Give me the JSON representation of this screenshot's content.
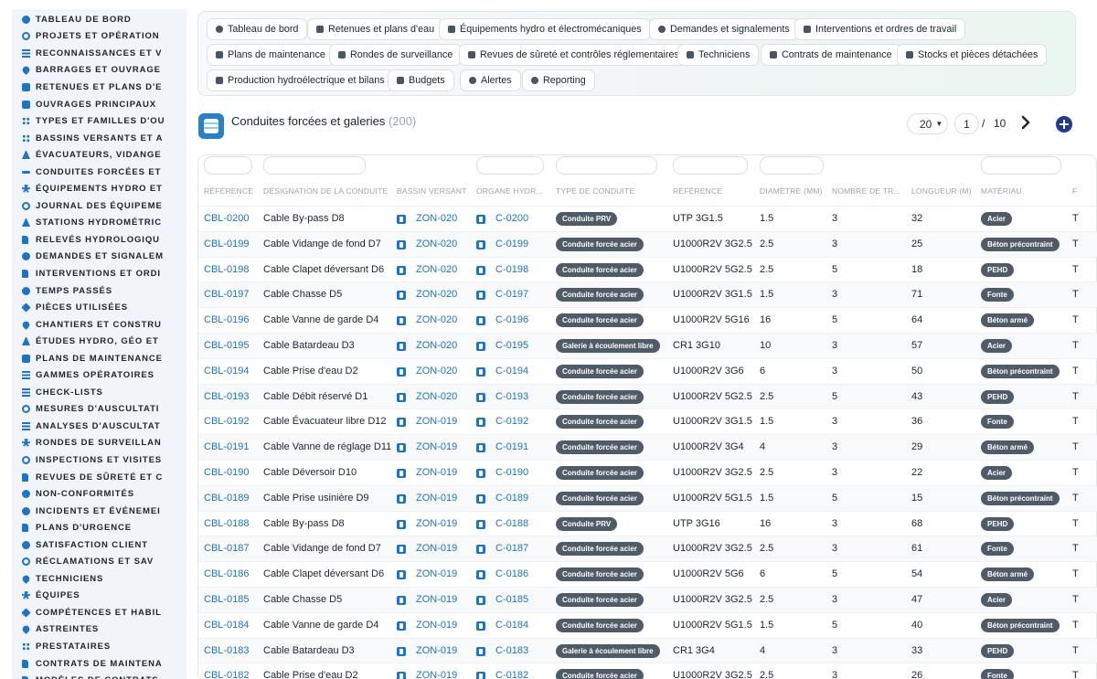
{
  "sidebar": {
    "items": [
      {
        "label": "TABLEAU DE BORD",
        "icon": "dashboard-icon"
      },
      {
        "label": "PROJETS ET OPÉRATION",
        "icon": "target-icon"
      },
      {
        "label": "RECONNAISSANCES ET V",
        "icon": "list-icon"
      },
      {
        "label": "BARRAGES ET OUVRAGE",
        "icon": "map-pin-icon"
      },
      {
        "label": "RETENUES ET PLANS D'E",
        "icon": "building-icon"
      },
      {
        "label": "OUVRAGES PRINCIPAUX",
        "icon": "box-icon"
      },
      {
        "label": "TYPES ET FAMILLES D'OU",
        "icon": "sitemap-icon"
      },
      {
        "label": "BASSINS VERSANTS ET A",
        "icon": "grid-icon"
      },
      {
        "label": "ÉVACUATEURS, VIDANGE",
        "icon": "valve-icon"
      },
      {
        "label": "CONDUITES FORCÉES ET",
        "icon": "pipe-icon"
      },
      {
        "label": "ÉQUIPEMENTS HYDRO ET",
        "icon": "cogs-icon"
      },
      {
        "label": "JOURNAL DES ÉQUIPEME",
        "icon": "history-icon"
      },
      {
        "label": "STATIONS HYDROMÉTRIC",
        "icon": "tower-icon"
      },
      {
        "label": "RELEVÉS HYDROLOGIQU",
        "icon": "clipboard-icon"
      },
      {
        "label": "DEMANDES ET SIGNALEM",
        "icon": "question-icon"
      },
      {
        "label": "INTERVENTIONS ET ORDI",
        "icon": "clipboard-check-icon"
      },
      {
        "label": "TEMPS PASSÉS",
        "icon": "clock-icon"
      },
      {
        "label": "PIÈCES UTILISÉES",
        "icon": "cube-icon"
      },
      {
        "label": "CHANTIERS ET CONSTRU",
        "icon": "hammer-icon"
      },
      {
        "label": "ÉTUDES HYDRO, GÉO ET",
        "icon": "flask-icon"
      },
      {
        "label": "PLANS DE MAINTENANCE",
        "icon": "calendar-icon"
      },
      {
        "label": "GAMMES OPÉRATOIRES",
        "icon": "list-ol-icon"
      },
      {
        "label": "CHECK-LISTS",
        "icon": "check-list-icon"
      },
      {
        "label": "MESURES D'AUSCULTATI",
        "icon": "gauge-icon"
      },
      {
        "label": "ANALYSES D'AUSCULTAT",
        "icon": "chart-icon"
      },
      {
        "label": "RONDES DE SURVEILLAN",
        "icon": "route-icon"
      },
      {
        "label": "INSPECTIONS ET VISITES",
        "icon": "search-icon"
      },
      {
        "label": "REVUES DE SÛRETÉ ET C",
        "icon": "file-shield-icon"
      },
      {
        "label": "NON-CONFORMITÉS",
        "icon": "warning-icon"
      },
      {
        "label": "INCIDENTS ET ÉVÉNEMEI",
        "icon": "alert-icon"
      },
      {
        "label": "PLANS D'URGENCE",
        "icon": "file-alert-icon"
      },
      {
        "label": "SATISFACTION CLIENT",
        "icon": "smile-icon"
      },
      {
        "label": "RÉCLAMATIONS ET SAV",
        "icon": "headset-icon"
      },
      {
        "label": "TECHNICIENS",
        "icon": "helmet-icon"
      },
      {
        "label": "ÉQUIPES",
        "icon": "users-icon"
      },
      {
        "label": "COMPÉTENCES ET HABIL",
        "icon": "certificate-icon"
      },
      {
        "label": "ASTREINTES",
        "icon": "phone-icon"
      },
      {
        "label": "PRESTATAIRES",
        "icon": "handshake-icon"
      },
      {
        "label": "CONTRATS DE MAINTENA",
        "icon": "contract-icon"
      },
      {
        "label": "MODÈLES DE CONTRATS",
        "icon": "template-icon"
      }
    ]
  },
  "nav": {
    "buttons": [
      {
        "label": "Tableau de bord",
        "icon": "dashboard-icon"
      },
      {
        "label": "Retenues et plans d'eau",
        "icon": "building-icon"
      },
      {
        "label": "Équipements hydro et électromécaniques",
        "icon": "cogs-icon"
      },
      {
        "label": "Demandes et signalements",
        "icon": "question-icon"
      },
      {
        "label": "Interventions et ordres de travail",
        "icon": "clipboard-check-icon"
      },
      {
        "label": "Plans de maintenance",
        "icon": "calendar-icon"
      },
      {
        "label": "Rondes de surveillance",
        "icon": "route-icon"
      },
      {
        "label": "Revues de sûreté et contrôles réglementaires",
        "icon": "file-shield-icon"
      },
      {
        "label": "Techniciens",
        "icon": "helmet-icon"
      },
      {
        "label": "Contrats de maintenance",
        "icon": "contract-icon"
      },
      {
        "label": "Stocks et pièces détachées",
        "icon": "boxes-icon"
      },
      {
        "label": "Production hydroélectrique et bilans",
        "icon": "bolt-icon"
      },
      {
        "label": "Budgets",
        "icon": "money-icon"
      },
      {
        "label": "Alertes",
        "icon": "bell-icon"
      },
      {
        "label": "Reporting",
        "icon": "pie-chart-icon"
      }
    ]
  },
  "page": {
    "title": "Conduites forcées et galeries",
    "count": "(200)",
    "per_page": "20",
    "current_page": "1",
    "page_separator": "/",
    "total_pages": "10"
  },
  "table": {
    "headers": [
      "RÉFÉRENCE",
      "DÉSIGNATION DE LA CONDUITE",
      "BASSIN VERSANT",
      "ORGANE HYDR...",
      "TYPE DE CONDUITE",
      "RÉFÉRENCE",
      "DIAMÈTRE (MM)",
      "NOMBRE DE TR...",
      "LONGUEUR (M)",
      "MATÉRIAU",
      "F"
    ],
    "rows": [
      {
        "ref": "CBL-0200",
        "name": "Cable By-pass D8",
        "basin": "ZON-020",
        "organ": "C-0200",
        "type": "Conduite PRV",
        "cable_ref": "UTP 3G1.5",
        "diameter": "1.5",
        "count": "3",
        "length": "32",
        "material": "Acier",
        "extra": "T"
      },
      {
        "ref": "CBL-0199",
        "name": "Cable Vidange de fond D7",
        "basin": "ZON-020",
        "organ": "C-0199",
        "type": "Conduite forcée acier",
        "cable_ref": "U1000R2V 3G2.5",
        "diameter": "2.5",
        "count": "3",
        "length": "25",
        "material": "Béton précontraint",
        "extra": "T"
      },
      {
        "ref": "CBL-0198",
        "name": "Cable Clapet déversant D6",
        "basin": "ZON-020",
        "organ": "C-0198",
        "type": "Conduite forcée acier",
        "cable_ref": "U1000R2V 5G2.5",
        "diameter": "2.5",
        "count": "5",
        "length": "18",
        "material": "PEHD",
        "extra": "T"
      },
      {
        "ref": "CBL-0197",
        "name": "Cable Chasse D5",
        "basin": "ZON-020",
        "organ": "C-0197",
        "type": "Conduite forcée acier",
        "cable_ref": "U1000R2V 3G1.5",
        "diameter": "1.5",
        "count": "3",
        "length": "71",
        "material": "Fonte",
        "extra": "T"
      },
      {
        "ref": "CBL-0196",
        "name": "Cable Vanne de garde D4",
        "basin": "ZON-020",
        "organ": "C-0196",
        "type": "Conduite forcée acier",
        "cable_ref": "U1000R2V 5G16",
        "diameter": "16",
        "count": "5",
        "length": "64",
        "material": "Béton armé",
        "extra": "T"
      },
      {
        "ref": "CBL-0195",
        "name": "Cable Batardeau D3",
        "basin": "ZON-020",
        "organ": "C-0195",
        "type": "Galerie à écoulement libre",
        "cable_ref": "CR1 3G10",
        "diameter": "10",
        "count": "3",
        "length": "57",
        "material": "Acier",
        "extra": "T"
      },
      {
        "ref": "CBL-0194",
        "name": "Cable Prise d'eau D2",
        "basin": "ZON-020",
        "organ": "C-0194",
        "type": "Conduite forcée acier",
        "cable_ref": "U1000R2V 3G6",
        "diameter": "6",
        "count": "3",
        "length": "50",
        "material": "Béton précontraint",
        "extra": "T"
      },
      {
        "ref": "CBL-0193",
        "name": "Cable Débit réservé D1",
        "basin": "ZON-020",
        "organ": "C-0193",
        "type": "Conduite forcée acier",
        "cable_ref": "U1000R2V 5G2.5",
        "diameter": "2.5",
        "count": "5",
        "length": "43",
        "material": "PEHD",
        "extra": "T"
      },
      {
        "ref": "CBL-0192",
        "name": "Cable Évacuateur libre D12",
        "basin": "ZON-019",
        "organ": "C-0192",
        "type": "Conduite forcée acier",
        "cable_ref": "U1000R2V 3G1.5",
        "diameter": "1.5",
        "count": "3",
        "length": "36",
        "material": "Fonte",
        "extra": "T"
      },
      {
        "ref": "CBL-0191",
        "name": "Cable Vanne de réglage D11",
        "basin": "ZON-019",
        "organ": "C-0191",
        "type": "Conduite forcée acier",
        "cable_ref": "U1000R2V 3G4",
        "diameter": "4",
        "count": "3",
        "length": "29",
        "material": "Béton armé",
        "extra": "T"
      },
      {
        "ref": "CBL-0190",
        "name": "Cable Déversoir D10",
        "basin": "ZON-019",
        "organ": "C-0190",
        "type": "Conduite forcée acier",
        "cable_ref": "U1000R2V 3G2.5",
        "diameter": "2.5",
        "count": "3",
        "length": "22",
        "material": "Acier",
        "extra": "T"
      },
      {
        "ref": "CBL-0189",
        "name": "Cable Prise usinière D9",
        "basin": "ZON-019",
        "organ": "C-0189",
        "type": "Conduite forcée acier",
        "cable_ref": "U1000R2V 5G1.5",
        "diameter": "1.5",
        "count": "5",
        "length": "15",
        "material": "Béton précontraint",
        "extra": "T"
      },
      {
        "ref": "CBL-0188",
        "name": "Cable By-pass D8",
        "basin": "ZON-019",
        "organ": "C-0188",
        "type": "Conduite PRV",
        "cable_ref": "UTP 3G16",
        "diameter": "16",
        "count": "3",
        "length": "68",
        "material": "PEHD",
        "extra": "T"
      },
      {
        "ref": "CBL-0187",
        "name": "Cable Vidange de fond D7",
        "basin": "ZON-019",
        "organ": "C-0187",
        "type": "Conduite forcée acier",
        "cable_ref": "U1000R2V 3G2.5",
        "diameter": "2.5",
        "count": "3",
        "length": "61",
        "material": "Fonte",
        "extra": "T"
      },
      {
        "ref": "CBL-0186",
        "name": "Cable Clapet déversant D6",
        "basin": "ZON-019",
        "organ": "C-0186",
        "type": "Conduite forcée acier",
        "cable_ref": "U1000R2V 5G6",
        "diameter": "6",
        "count": "5",
        "length": "54",
        "material": "Béton armé",
        "extra": "T"
      },
      {
        "ref": "CBL-0185",
        "name": "Cable Chasse D5",
        "basin": "ZON-019",
        "organ": "C-0185",
        "type": "Conduite forcée acier",
        "cable_ref": "U1000R2V 3G2.5",
        "diameter": "2.5",
        "count": "3",
        "length": "47",
        "material": "Acier",
        "extra": "T"
      },
      {
        "ref": "CBL-0184",
        "name": "Cable Vanne de garde D4",
        "basin": "ZON-019",
        "organ": "C-0184",
        "type": "Conduite forcée acier",
        "cable_ref": "U1000R2V 5G1.5",
        "diameter": "1.5",
        "count": "5",
        "length": "40",
        "material": "Béton précontraint",
        "extra": "T"
      },
      {
        "ref": "CBL-0183",
        "name": "Cable Batardeau D3",
        "basin": "ZON-019",
        "organ": "C-0183",
        "type": "Galerie à écoulement libre",
        "cable_ref": "CR1 3G4",
        "diameter": "4",
        "count": "3",
        "length": "33",
        "material": "PEHD",
        "extra": "T"
      },
      {
        "ref": "CBL-0182",
        "name": "Cable Prise d'eau D2",
        "basin": "ZON-019",
        "organ": "C-0182",
        "type": "Conduite forcée acier",
        "cable_ref": "U1000R2V 3G2.5",
        "diameter": "2.5",
        "count": "3",
        "length": "26",
        "material": "Fonte",
        "extra": "T"
      }
    ]
  },
  "colors": {
    "accent": "#1e73c4",
    "badge": "#4f5b68",
    "add_button": "#1f3a8f"
  }
}
